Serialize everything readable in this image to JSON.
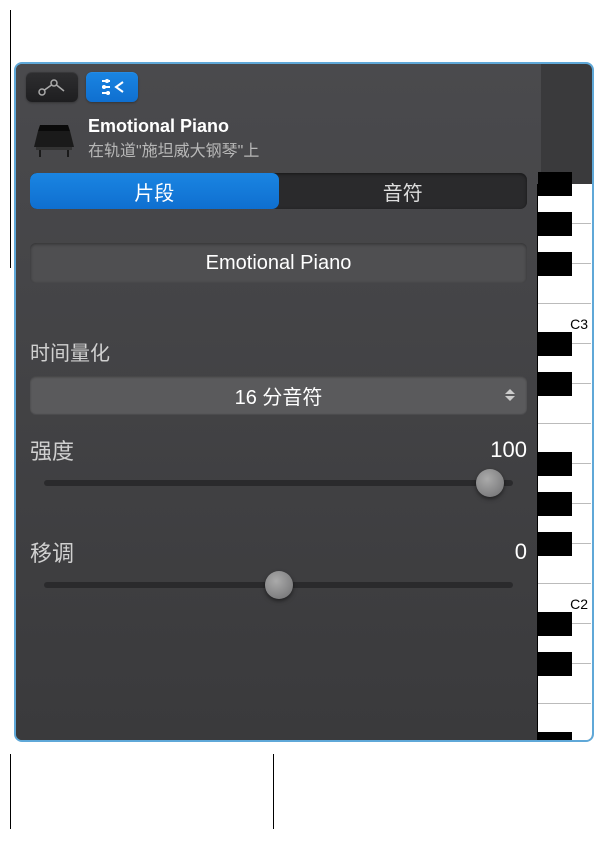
{
  "header": {
    "title": "Emotional Piano",
    "subtitle": "在轨道\"施坦威大钢琴\"上"
  },
  "tabs": {
    "region_label": "片段",
    "notes_label": "音符"
  },
  "region_name": "Emotional Piano",
  "quantize": {
    "label": "时间量化",
    "value": "16 分音符"
  },
  "strength": {
    "label": "强度",
    "value": "100",
    "percent": 95
  },
  "transpose": {
    "label": "移调",
    "value": "0",
    "percent": 50
  },
  "keyboard": {
    "labels": {
      "c3": "C3",
      "c2": "C2"
    }
  }
}
